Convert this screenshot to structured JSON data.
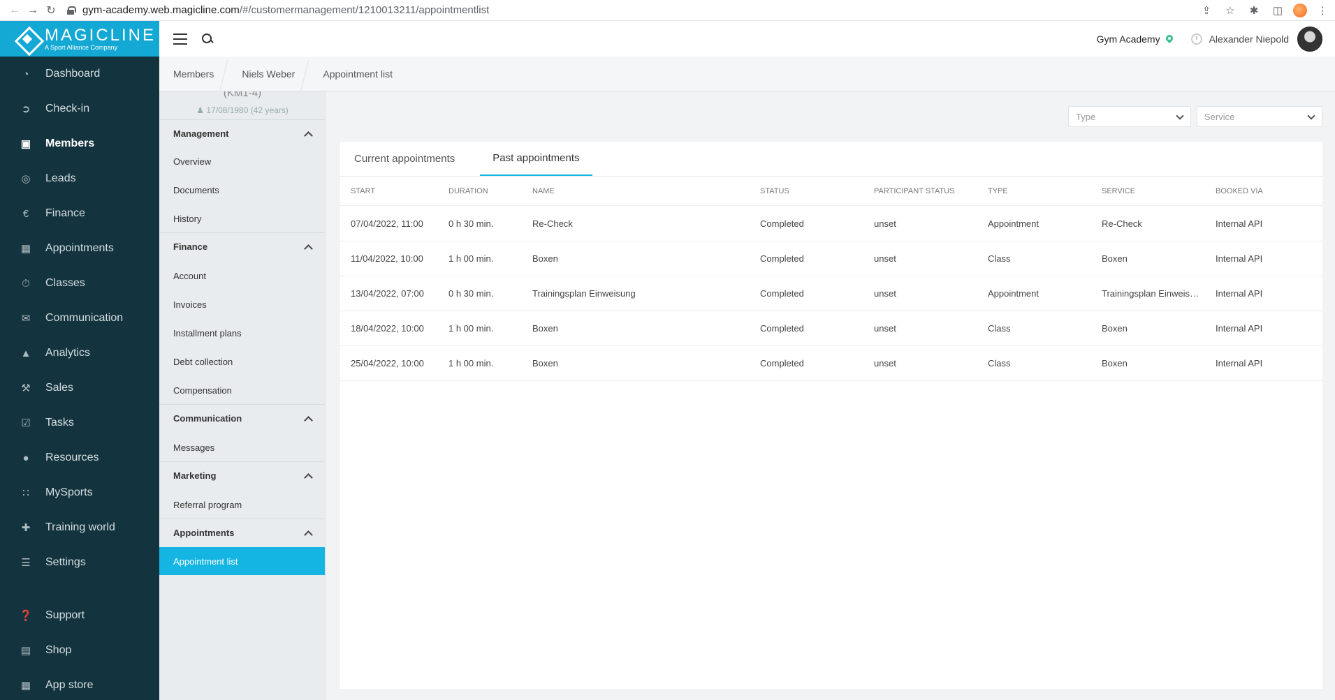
{
  "browser": {
    "url_host": "gym-academy.web.magicline.com",
    "url_path": "/#/customermanagement/1210013211/appointmentlist"
  },
  "brand": {
    "name": "MAGICLINE",
    "tagline": "A Sport Alliance Company"
  },
  "nav": {
    "items": [
      {
        "label": "Dashboard",
        "icon": "dashboard-icon"
      },
      {
        "label": "Check-in",
        "icon": "check-in-icon"
      },
      {
        "label": "Members",
        "icon": "members-icon"
      },
      {
        "label": "Leads",
        "icon": "leads-icon"
      },
      {
        "label": "Finance",
        "icon": "finance-icon"
      },
      {
        "label": "Appointments",
        "icon": "calendar-icon"
      },
      {
        "label": "Classes",
        "icon": "classes-icon"
      },
      {
        "label": "Communication",
        "icon": "chat-icon"
      },
      {
        "label": "Analytics",
        "icon": "analytics-icon"
      },
      {
        "label": "Sales",
        "icon": "cart-icon"
      },
      {
        "label": "Tasks",
        "icon": "tasks-icon"
      },
      {
        "label": "Resources",
        "icon": "resources-icon"
      },
      {
        "label": "MySports",
        "icon": "mysports-icon"
      },
      {
        "label": "Training world",
        "icon": "dumbbell-icon"
      },
      {
        "label": "Settings",
        "icon": "settings-icon"
      },
      {
        "label": "Support",
        "icon": "support-icon"
      },
      {
        "label": "Shop",
        "icon": "shop-icon"
      },
      {
        "label": "App store",
        "icon": "app-store-icon"
      }
    ],
    "active": "Members"
  },
  "header": {
    "studio": "Gym Academy",
    "user": "Alexander Niepold"
  },
  "breadcrumb": [
    "Members",
    "Niels Weber",
    "Appointment list"
  ],
  "member": {
    "id": "(KM1-4)",
    "dob": "17/08/1980 (42 years)"
  },
  "subnav": {
    "management": {
      "title": "Management",
      "items": [
        "Overview",
        "Documents",
        "History"
      ]
    },
    "finance": {
      "title": "Finance",
      "items": [
        "Account",
        "Invoices",
        "Installment plans",
        "Debt collection",
        "Compensation"
      ]
    },
    "communication": {
      "title": "Communication",
      "items": [
        "Messages"
      ]
    },
    "marketing": {
      "title": "Marketing",
      "items": [
        "Referral program"
      ]
    },
    "appointments": {
      "title": "Appointments",
      "items": [
        "Appointment list"
      ]
    }
  },
  "filters": {
    "type": "Type",
    "service": "Service"
  },
  "tabs": {
    "current": "Current appointments",
    "past": "Past appointments",
    "active": "Past appointments"
  },
  "table": {
    "headers": [
      "START",
      "DURATION",
      "NAME",
      "STATUS",
      "PARTICIPANT STATUS",
      "TYPE",
      "SERVICE",
      "BOOKED VIA"
    ],
    "rows": [
      [
        "07/04/2022, 11:00",
        "0 h 30 min.",
        "Re-Check",
        "Completed",
        "unset",
        "Appointment",
        "Re-Check",
        "Internal API"
      ],
      [
        "11/04/2022, 10:00",
        "1 h 00 min.",
        "Boxen",
        "Completed",
        "unset",
        "Class",
        "Boxen",
        "Internal API"
      ],
      [
        "13/04/2022, 07:00",
        "0 h 30 min.",
        "Trainingsplan Einweisung",
        "Completed",
        "unset",
        "Appointment",
        "Trainingsplan Einweisung",
        "Internal API"
      ],
      [
        "18/04/2022, 10:00",
        "1 h 00 min.",
        "Boxen",
        "Completed",
        "unset",
        "Class",
        "Boxen",
        "Internal API"
      ],
      [
        "25/04/2022, 10:00",
        "1 h 00 min.",
        "Boxen",
        "Completed",
        "unset",
        "Class",
        "Boxen",
        "Internal API"
      ]
    ]
  },
  "colors": {
    "accent": "#14b5e2",
    "nav_bg": "#13333e",
    "brand_bg": "#14a9d5"
  }
}
